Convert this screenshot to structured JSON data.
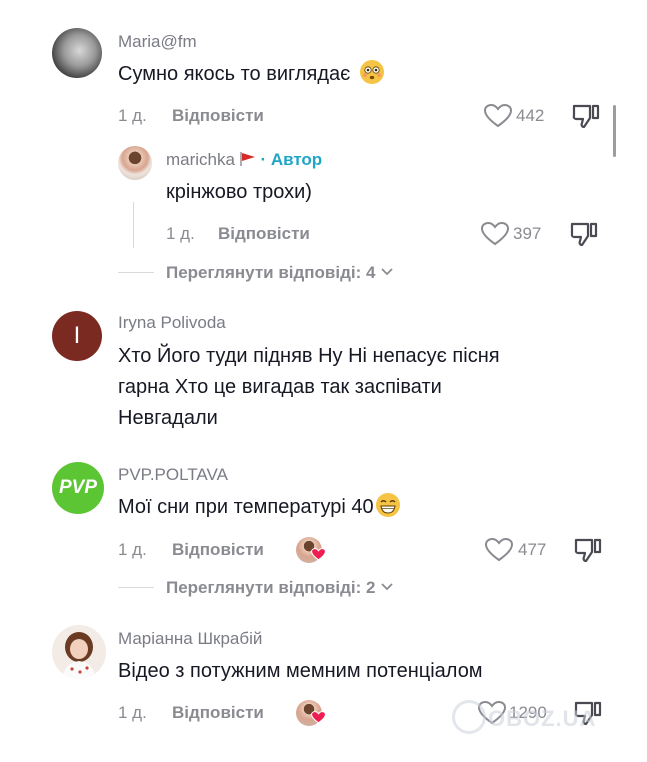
{
  "comments": [
    {
      "username": "Maria@fm",
      "text": "Сумно якось то виглядає",
      "time": "1 д.",
      "reply_label": "Відповісти",
      "likes": "442"
    },
    {
      "username": "marichka",
      "author_badge": "· Автор",
      "text": "крінжово трохи)",
      "time": "1 д.",
      "reply_label": "Відповісти",
      "likes": "397"
    },
    {
      "username": "Iryna Polivoda",
      "avatar_letter": "I",
      "text_lines": [
        "Хто Його туди підняв Ну Ні непасує пісня",
        "гарна Хто це вигадав так заспівати",
        "Невгадали"
      ]
    },
    {
      "username": "PVP.POLTAVA",
      "avatar_text": "PVP",
      "text": "Мої сни при температурі 40",
      "time": "1 д.",
      "reply_label": "Відповісти",
      "likes": "477"
    },
    {
      "username": "Маріанна Шкрабій",
      "text": "Відео з потужним мемним потенціалом",
      "time": "1 д.",
      "reply_label": "Відповісти",
      "likes": "1290"
    }
  ],
  "view_replies": [
    "Переглянути відповіді: 4",
    "Переглянути відповіді: 2"
  ],
  "watermark": "OBOZ.UA",
  "colors": {
    "author_badge": "#20a6c4",
    "pvp_green": "#5cc534",
    "iryna_avatar": "#7a2a20",
    "liked_heart": "#ee1d52"
  }
}
